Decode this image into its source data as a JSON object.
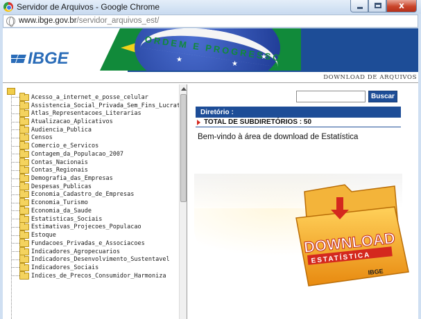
{
  "window": {
    "title": "Servidor de Arquivos - Google Chrome",
    "close_glyph": "x"
  },
  "address": {
    "host": "www.ibge.gov.br",
    "path": "/servidor_arquivos_est/"
  },
  "banner": {
    "logo_text": "IBGE",
    "motto": "ORDEM E PROGRESSO",
    "section_title": "DOWNLOAD DE ARQUIVOS"
  },
  "tree": {
    "items": [
      "Acesso_a_internet_e_posse_celular",
      "Assistencia_Social_Privada_Sem_Fins_Lucrat",
      "Atlas_Representacoes_Literarias",
      "Atualizacao_Aplicativos",
      "Audiencia_Publica",
      "Censos",
      "Comercio_e_Servicos",
      "Contagem_da_Populacao_2007",
      "Contas_Nacionais",
      "Contas_Regionais",
      "Demografia_das_Empresas",
      "Despesas_Publicas",
      "Economia_Cadastro_de_Empresas",
      "Economia_Turismo",
      "Economia_da_Saude",
      "Estatisticas_Sociais",
      "Estimativas_Projecoes_Populacao",
      "Estoque",
      "Fundacoes_Privadas_e_Associacoes",
      "Indicadores_Agropecuarios",
      "Indicadores_Desenvolvimento_Sustentavel",
      "Indicadores_Sociais",
      "Indices_de_Precos_Consumidor_Harmoniza"
    ]
  },
  "search": {
    "value": "",
    "button_label": "Buscar"
  },
  "directory": {
    "header": "Diretório :",
    "total": "TOTAL DE SUBDIRETÓRIOS : 50",
    "welcome": "Bem-vindo à área de download de Estatística"
  },
  "graphic": {
    "line1": "DOWNLOAD",
    "line2": "ESTATÍSTICA",
    "brand": "IBGE"
  },
  "colors": {
    "ibge_blue": "#1d4d97",
    "flag_green": "#118a3a",
    "flag_yellow": "#f1d21a",
    "folder_orange": "#f0a020",
    "download_red": "#d4281e"
  }
}
